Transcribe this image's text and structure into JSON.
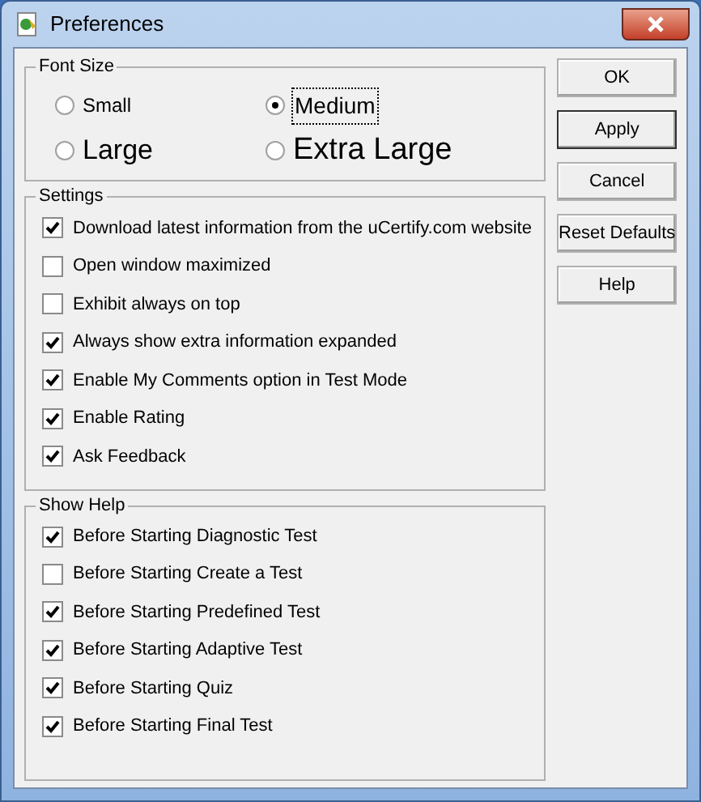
{
  "window": {
    "title": "Preferences"
  },
  "font_size": {
    "title": "Font Size",
    "options": [
      {
        "label": "Small",
        "selected": false,
        "kind": "small"
      },
      {
        "label": "Medium",
        "selected": true,
        "kind": "medium"
      },
      {
        "label": "Large",
        "selected": false,
        "kind": "large"
      },
      {
        "label": "Extra Large",
        "selected": false,
        "kind": "xlarge"
      }
    ]
  },
  "settings": {
    "title": "Settings",
    "items": [
      {
        "label": "Download latest information from the uCertify.com website",
        "checked": true
      },
      {
        "label": "Open window maximized",
        "checked": false
      },
      {
        "label": "Exhibit always on top",
        "checked": false
      },
      {
        "label": "Always show extra information expanded",
        "checked": true
      },
      {
        "label": "Enable My Comments option in Test Mode",
        "checked": true
      },
      {
        "label": "Enable Rating",
        "checked": true
      },
      {
        "label": "Ask Feedback",
        "checked": true
      }
    ]
  },
  "show_help": {
    "title": "Show Help",
    "items": [
      {
        "label": "Before Starting Diagnostic Test",
        "checked": true
      },
      {
        "label": "Before Starting Create a Test",
        "checked": false
      },
      {
        "label": "Before Starting Predefined Test",
        "checked": true
      },
      {
        "label": "Before Starting Adaptive Test",
        "checked": true
      },
      {
        "label": "Before Starting Quiz",
        "checked": true
      },
      {
        "label": "Before Starting Final Test",
        "checked": true
      }
    ]
  },
  "buttons": [
    {
      "label": "OK",
      "default": false
    },
    {
      "label": "Apply",
      "default": true
    },
    {
      "label": "Cancel",
      "default": false
    },
    {
      "label": "Reset Defaults",
      "default": false
    },
    {
      "label": "Help",
      "default": false
    }
  ]
}
